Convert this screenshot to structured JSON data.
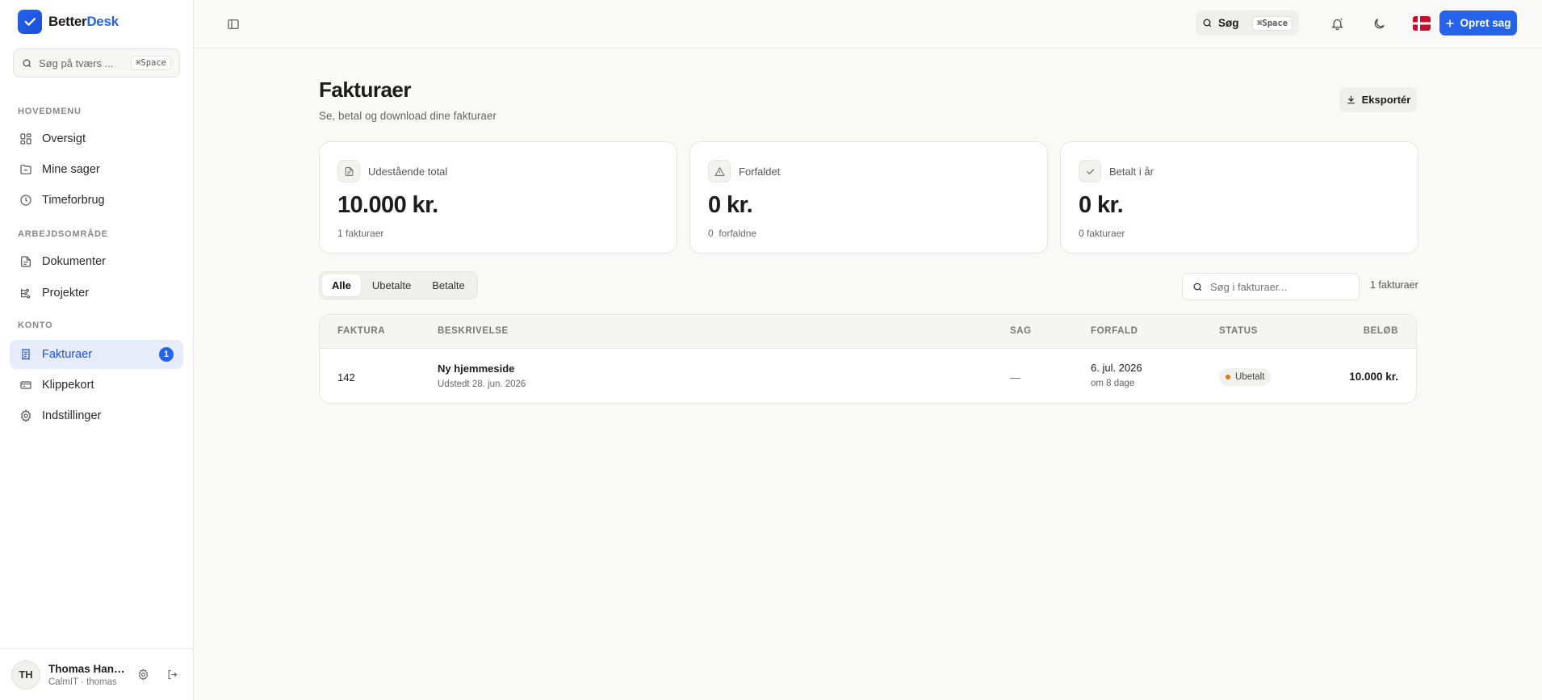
{
  "brand": {
    "name_part1": "Better",
    "name_part2": "Desk",
    "accent": "#2563eb"
  },
  "sidebar": {
    "search_placeholder": "Søg på tværs ...",
    "search_shortcut": "⌘Space",
    "sections": {
      "main": "HOVEDMENU",
      "workspace": "ARBEJDSOMRÅDE",
      "account": "KONTO"
    },
    "items": [
      {
        "label": "Oversigt",
        "icon": "grid-icon"
      },
      {
        "label": "Mine sager",
        "icon": "folder-icon"
      },
      {
        "label": "Timeforbrug",
        "icon": "clock-icon"
      },
      {
        "label": "Dokumenter",
        "icon": "document-icon"
      },
      {
        "label": "Projekter",
        "icon": "project-icon"
      },
      {
        "label": "Fakturaer",
        "icon": "invoice-icon",
        "badge": "1",
        "active": true
      },
      {
        "label": "Klippekort",
        "icon": "card-icon"
      },
      {
        "label": "Indstillinger",
        "icon": "gear-icon"
      }
    ],
    "user": {
      "initials": "TH",
      "name": "Thomas Hans...",
      "sub": "CalmIT · thomas"
    }
  },
  "topbar": {
    "search_label": "Søg",
    "search_shortcut": "⌘Space",
    "create_label": "Opret sag"
  },
  "page": {
    "title": "Fakturaer",
    "subtitle": "Se, betal og download dine fakturaer",
    "export_label": "Eksportér"
  },
  "stats": [
    {
      "label": "Udestående total",
      "value": "10.000 kr.",
      "foot": "1 fakturaer",
      "icon": "document-icon"
    },
    {
      "label": "Forfaldet",
      "value": "0 kr.",
      "foot": "0  forfaldne",
      "icon": "warning-icon"
    },
    {
      "label": "Betalt i år",
      "value": "0 kr.",
      "foot": "0 fakturaer",
      "icon": "check-icon"
    }
  ],
  "filters": {
    "tabs": [
      "Alle",
      "Ubetalte",
      "Betalte"
    ],
    "active_tab": "Alle",
    "search_placeholder": "Søg i fakturaer...",
    "count": "1 fakturaer"
  },
  "table": {
    "columns": [
      "FAKTURA",
      "BESKRIVELSE",
      "SAG",
      "FORFALD",
      "STATUS",
      "BELØB"
    ],
    "rows": [
      {
        "invoice": "142",
        "description": "Ny hjemmeside",
        "issued": "Udstedt 28. jun. 2026",
        "case": "—",
        "due": "6. jul. 2026",
        "due_rel": "om 8 dage",
        "status": "Ubetalt",
        "status_color": "#e27a10",
        "amount": "10.000 kr."
      }
    ]
  }
}
